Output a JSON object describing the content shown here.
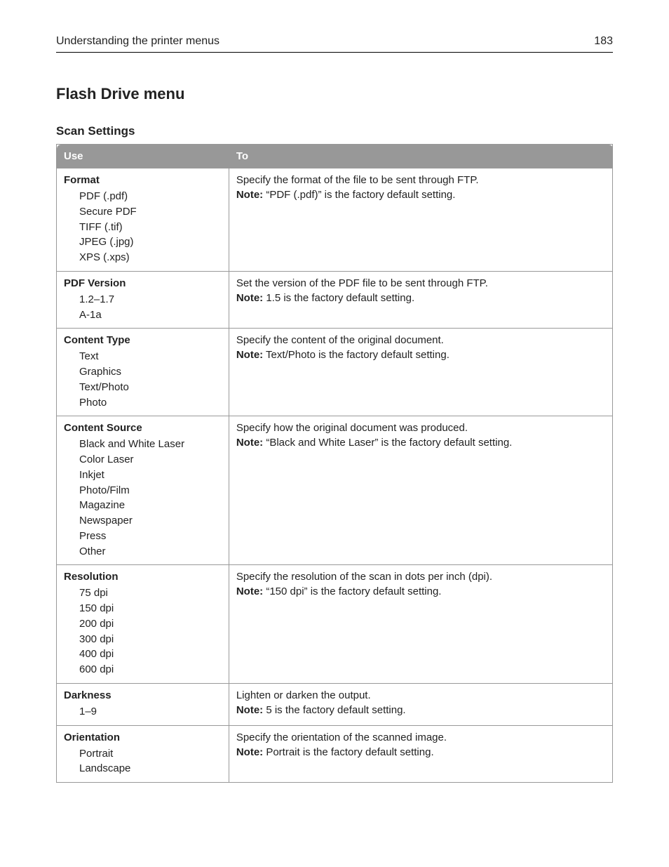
{
  "header": {
    "left": "Understanding the printer menus",
    "right": "183"
  },
  "title": "Flash Drive menu",
  "subtitle": "Scan Settings",
  "table": {
    "head": {
      "use": "Use",
      "to": "To"
    },
    "rows": [
      {
        "name": "Format",
        "values": [
          "PDF (.pdf)",
          "Secure PDF",
          "TIFF (.tif)",
          "JPEG (.jpg)",
          "XPS (.xps)"
        ],
        "desc": "Specify the format of the file to be sent through FTP.",
        "note_label": "Note:",
        "note": " “PDF (.pdf)” is the factory default setting."
      },
      {
        "name": "PDF Version",
        "values": [
          "1.2–1.7",
          "A‑1a"
        ],
        "desc": "Set the version of the PDF file to be sent through FTP.",
        "note_label": "Note:",
        "note": " 1.5 is the factory default setting."
      },
      {
        "name": "Content Type",
        "values": [
          "Text",
          "Graphics",
          "Text/Photo",
          "Photo"
        ],
        "desc": "Specify the content of the original document.",
        "note_label": "Note:",
        "note": " Text/Photo is the factory default setting."
      },
      {
        "name": "Content Source",
        "values": [
          "Black and White Laser",
          "Color Laser",
          "Inkjet",
          "Photo/Film",
          "Magazine",
          "Newspaper",
          "Press",
          "Other"
        ],
        "desc": "Specify how the original document was produced.",
        "note_label": "Note:",
        "note": " “Black and White Laser” is the factory default setting."
      },
      {
        "name": "Resolution",
        "values": [
          "75 dpi",
          "150 dpi",
          "200 dpi",
          "300 dpi",
          "400 dpi",
          "600 dpi"
        ],
        "desc": "Specify the resolution of the scan in dots per inch (dpi).",
        "note_label": "Note:",
        "note": " “150 dpi” is the factory default setting."
      },
      {
        "name": "Darkness",
        "values": [
          "1–9"
        ],
        "desc": "Lighten or darken the output.",
        "note_label": "Note:",
        "note": " 5 is the factory default setting."
      },
      {
        "name": "Orientation",
        "values": [
          "Portrait",
          "Landscape"
        ],
        "desc": "Specify the orientation of the scanned image.",
        "note_label": "Note:",
        "note": " Portrait is the factory default setting."
      }
    ]
  }
}
